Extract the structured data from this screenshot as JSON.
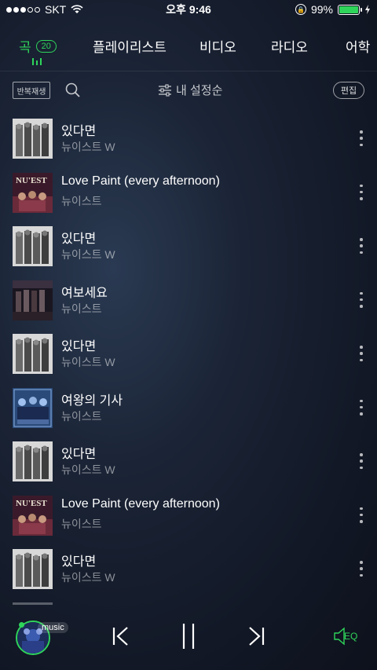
{
  "status_bar": {
    "carrier": "SKT",
    "time": "오후 9:46",
    "battery_percent": "99%",
    "battery_level": 0.99,
    "signal_bars_filled": 3,
    "signal_bars_total": 5
  },
  "tabs": [
    {
      "label": "곡",
      "badge": "20",
      "active": true
    },
    {
      "label": "플레이리스트",
      "active": false
    },
    {
      "label": "비디오",
      "active": false
    },
    {
      "label": "라디오",
      "active": false
    },
    {
      "label": "어학",
      "active": false
    }
  ],
  "toolbar": {
    "repeat_label": "반복재생",
    "sort_label": "내 설정순",
    "edit_label": "편집"
  },
  "songs": [
    {
      "title": "있다면",
      "artist": "뉴이스트 W",
      "art": "gray"
    },
    {
      "title": "Love Paint (every afternoon)",
      "artist": "뉴이스트",
      "art": "nuest"
    },
    {
      "title": "있다면",
      "artist": "뉴이스트 W",
      "art": "gray"
    },
    {
      "title": "여보세요",
      "artist": "뉴이스트",
      "art": "dark"
    },
    {
      "title": "있다면",
      "artist": "뉴이스트 W",
      "art": "gray"
    },
    {
      "title": "여왕의 기사",
      "artist": "뉴이스트",
      "art": "blue"
    },
    {
      "title": "있다면",
      "artist": "뉴이스트 W",
      "art": "gray"
    },
    {
      "title": "Love Paint (every afternoon)",
      "artist": "뉴이스트",
      "art": "nuest"
    },
    {
      "title": "있다면",
      "artist": "뉴이스트 W",
      "art": "gray"
    }
  ],
  "player": {
    "badge_label": "music",
    "eq_label": "EQ"
  },
  "colors": {
    "accent": "#2fd45a",
    "background": "#151d2c"
  }
}
